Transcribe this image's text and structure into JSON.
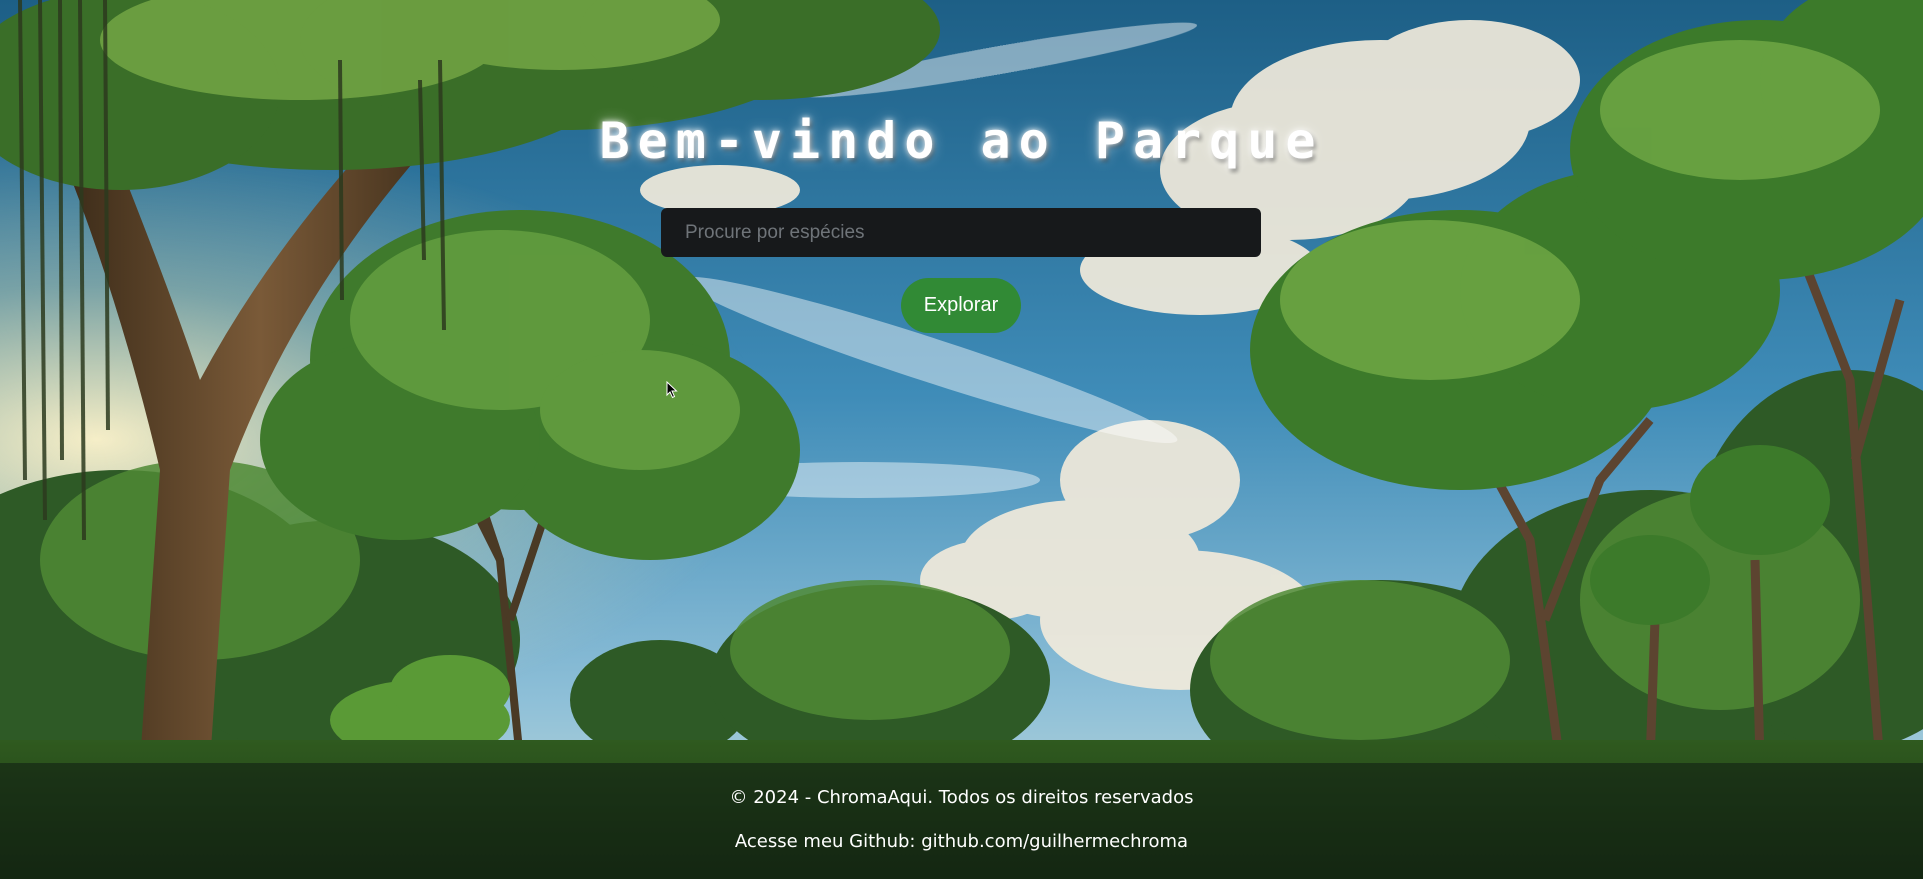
{
  "hero": {
    "title": "Bem-vindo ao Parque",
    "search": {
      "placeholder": "Procure por espécies",
      "value": ""
    },
    "explore_button": "Explorar"
  },
  "footer": {
    "copyright": "© 2024 - ChromaAqui. Todos os direitos reservados",
    "github_prefix": "Acesse meu Github:",
    "github_link": "github.com/guilhermechroma"
  },
  "colors": {
    "button": "#318a35",
    "search_bg": "#17191b",
    "title": "#ffffff"
  },
  "icons": {
    "cursor": "mouse-pointer-icon"
  }
}
